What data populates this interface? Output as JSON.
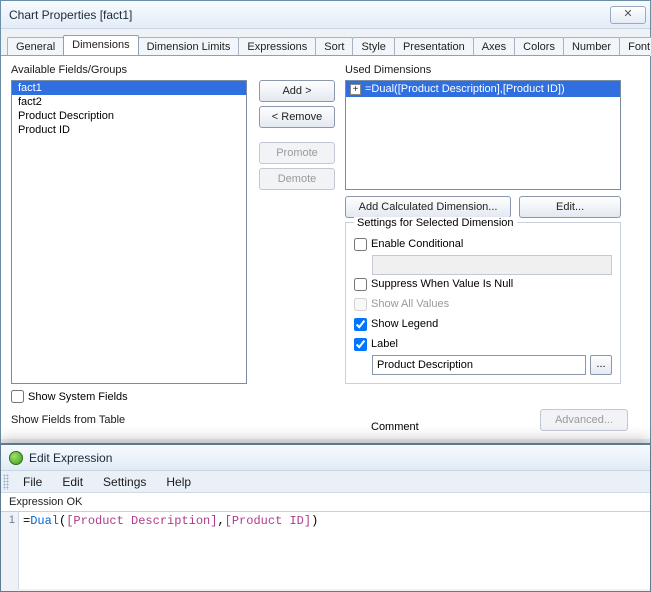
{
  "chartWin": {
    "title": "Chart Properties [fact1]",
    "closeGlyph": "✕",
    "tabs": {
      "general": "General",
      "dimensions": "Dimensions",
      "dimLimits": "Dimension Limits",
      "expressions": "Expressions",
      "sort": "Sort",
      "style": "Style",
      "presentation": "Presentation",
      "axes": "Axes",
      "colors": "Colors",
      "number": "Number",
      "font": "Font"
    },
    "scroll": {
      "left": "◂",
      "right": "▸"
    },
    "available": {
      "label": "Available Fields/Groups",
      "items": [
        "fact1",
        "fact2",
        "Product Description",
        "Product ID"
      ],
      "selectedIndex": 0
    },
    "buttons": {
      "add": "Add >",
      "remove": "< Remove",
      "promote": "Promote",
      "demote": "Demote"
    },
    "used": {
      "label": "Used Dimensions",
      "item0": "=Dual([Product Description],[Product ID])",
      "addCalc": "Add Calculated Dimension...",
      "edit": "Edit..."
    },
    "settings": {
      "legend": "Settings for Selected Dimension",
      "enableCond": "Enable Conditional",
      "suppressNull": "Suppress When Value Is Null",
      "showAll": "Show All Values",
      "showLegend": "Show Legend",
      "labelChk": "Label",
      "labelValue": "Product Description",
      "browse": "...",
      "comment": "Comment",
      "advanced": "Advanced..."
    },
    "sysFields": "Show System Fields",
    "showFromTable": "Show Fields from Table"
  },
  "exprWin": {
    "title": "Edit Expression",
    "menu": {
      "file": "File",
      "edit": "Edit",
      "settings": "Settings",
      "help": "Help"
    },
    "status": "Expression OK",
    "gutter1": "1",
    "code": {
      "eq": "=",
      "fn": "Dual",
      "open": "(",
      "f1": "[Product Description]",
      "comma": ",",
      "f2": "[Product ID]",
      "close": ")"
    }
  }
}
